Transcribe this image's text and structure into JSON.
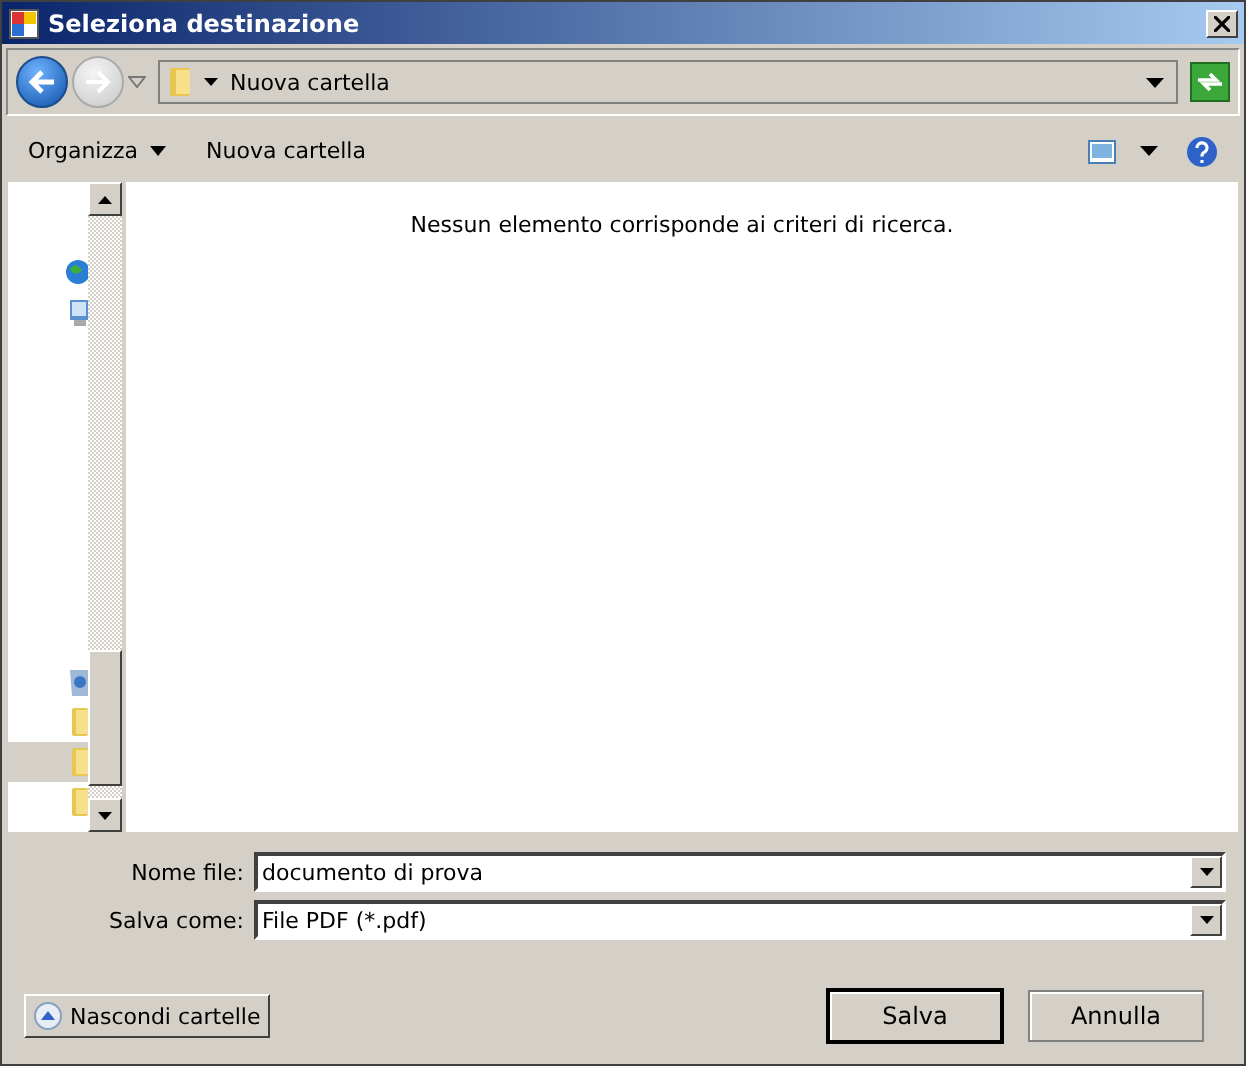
{
  "window": {
    "title": "Seleziona destinazione"
  },
  "address_bar": {
    "path": "Nuova cartella"
  },
  "toolbar": {
    "items": [
      {
        "label": "Organizza",
        "kind": "menu"
      },
      {
        "label": "Nuova cartella",
        "kind": "button"
      }
    ]
  },
  "nav_pane": {
    "items": [
      {
        "kind": "globe",
        "selected": false
      },
      {
        "kind": "monitor",
        "selected": false
      },
      {
        "kind": "recycle",
        "selected": false
      },
      {
        "kind": "folder",
        "selected": false
      },
      {
        "kind": "folder",
        "selected": true
      },
      {
        "kind": "folder",
        "selected": false
      }
    ]
  },
  "content": {
    "empty_message": "Nessun elemento corrisponde ai criteri di ricerca."
  },
  "fields": [
    {
      "label": "Nome file:",
      "value": "documento di prova"
    },
    {
      "label": "Salva come:",
      "value": "File PDF (*.pdf)"
    }
  ],
  "hide_folders": {
    "label": "Nascondi cartelle"
  },
  "buttons": [
    {
      "label": "Salva",
      "default": true
    },
    {
      "label": "Annulla",
      "default": false
    }
  ]
}
